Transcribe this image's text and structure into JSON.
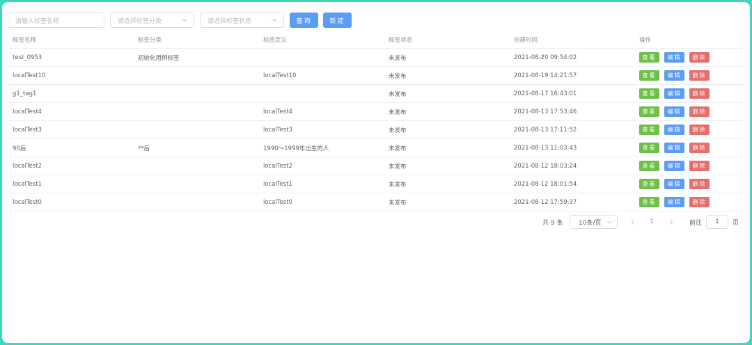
{
  "filters": {
    "name_placeholder": "请输入标签名称",
    "category_placeholder": "请选择标签分类",
    "status_placeholder": "请选择标签状态",
    "query_label": "查询",
    "new_label": "新建"
  },
  "table": {
    "columns": [
      "标签名称",
      "标签分类",
      "标签定义",
      "标签状态",
      "创建时间",
      "操作"
    ],
    "rows": [
      {
        "name": "test_0953",
        "category": "初始化用例标签",
        "definition": "",
        "status": "未发布",
        "created": "2021-08-20 09:54:02"
      },
      {
        "name": "localTest10",
        "category": "",
        "definition": "localTest10",
        "status": "未发布",
        "created": "2021-08-19 14:21:57"
      },
      {
        "name": "g1_tag1",
        "category": "",
        "definition": "",
        "status": "未发布",
        "created": "2021-08-17 16:43:01"
      },
      {
        "name": "localTest4",
        "category": "",
        "definition": "localTest4",
        "status": "未发布",
        "created": "2021-08-13 17:53:46"
      },
      {
        "name": "localTest3",
        "category": "",
        "definition": "localTest3",
        "status": "未发布",
        "created": "2021-08-13 17:11:52"
      },
      {
        "name": "90后",
        "category": "**后",
        "definition": "1990～1999年出生的人",
        "status": "未发布",
        "created": "2021-08-13 11:03:43"
      },
      {
        "name": "localTest2",
        "category": "",
        "definition": "localTest2",
        "status": "未发布",
        "created": "2021-08-12 18:03:24"
      },
      {
        "name": "localTest1",
        "category": "",
        "definition": "localTest1",
        "status": "未发布",
        "created": "2021-08-12 18:01:54"
      },
      {
        "name": "localTest0",
        "category": "",
        "definition": "localTest0",
        "status": "未发布",
        "created": "2021-08-12 17:59:37"
      }
    ],
    "actions": {
      "view": "查看",
      "edit": "编辑",
      "delete": "删除"
    }
  },
  "pagination": {
    "total": "共 9 条",
    "page_size": "10条/页",
    "current_page": "1",
    "goto_label": "前往",
    "goto_value": "1",
    "goto_suffix": "页"
  },
  "icons": {
    "chevron_down": "chevron-down-icon",
    "prev": "chevron-left-icon",
    "next": "chevron-right-icon"
  },
  "colors": {
    "primary": "#5b9cf5",
    "view": "#6fbf4a",
    "edit": "#5b9cf5",
    "delete": "#e46f6b",
    "border": "#3fd6bf"
  }
}
